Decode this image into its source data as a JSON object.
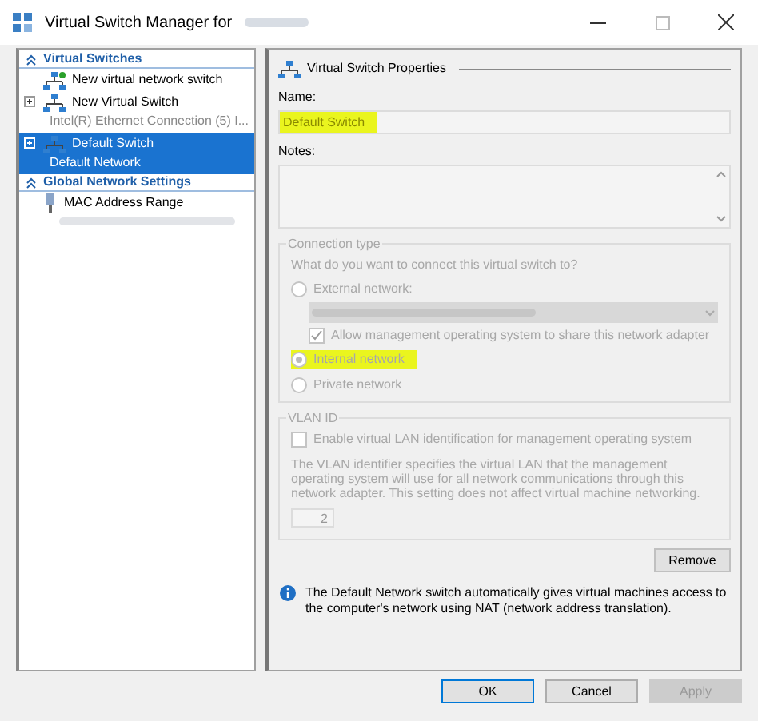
{
  "window": {
    "title": "Virtual Switch Manager for"
  },
  "sidebar": {
    "sections": [
      {
        "title": "Virtual Switches",
        "expanded": true,
        "items": [
          {
            "kind": "add",
            "label": "New virtual network switch",
            "expandable": false,
            "selected": false
          },
          {
            "kind": "switch",
            "label": "New Virtual Switch",
            "subtitle": "Intel(R) Ethernet Connection (5) I...",
            "expandable": true,
            "selected": false
          },
          {
            "kind": "switch",
            "label": "Default Switch",
            "subtitle": "Default Network",
            "expandable": true,
            "selected": true
          }
        ]
      },
      {
        "title": "Global Network Settings",
        "expanded": true,
        "items": [
          {
            "kind": "mac",
            "label": "MAC Address Range",
            "expandable": false,
            "selected": false
          }
        ]
      }
    ]
  },
  "properties": {
    "title": "Virtual Switch Properties",
    "name_label": "Name:",
    "name_value": "Default Switch",
    "name_highlighted": true,
    "notes_label": "Notes:",
    "connection_type": {
      "title": "Connection type",
      "disabled": true,
      "question": "What do you want to connect this virtual switch to?",
      "options": [
        {
          "kind": "external",
          "label": "External network:",
          "selected": false,
          "highlighted": false
        },
        {
          "kind": "internal",
          "label": "Internal network",
          "selected": true,
          "highlighted": true
        },
        {
          "kind": "private",
          "label": "Private network",
          "selected": false,
          "highlighted": false
        }
      ],
      "share_label": "Allow management operating system to share this network adapter",
      "share_checked": true
    },
    "vlan": {
      "title": "VLAN ID",
      "disabled": true,
      "enable_label": "Enable virtual LAN identification for management operating system",
      "enable_checked": false,
      "description": "The VLAN identifier specifies the virtual LAN that the management operating system will use for all network communications through this network adapter. This setting does not affect virtual machine networking.",
      "value": "2"
    },
    "remove_button": "Remove",
    "info": "The Default Network switch automatically gives virtual machines access to the computer's network using NAT (network address translation)."
  },
  "buttons": [
    {
      "label": "OK",
      "disabled": false,
      "default": true
    },
    {
      "label": "Cancel",
      "disabled": false,
      "default": false
    },
    {
      "label": "Apply",
      "disabled": true,
      "default": false
    }
  ]
}
